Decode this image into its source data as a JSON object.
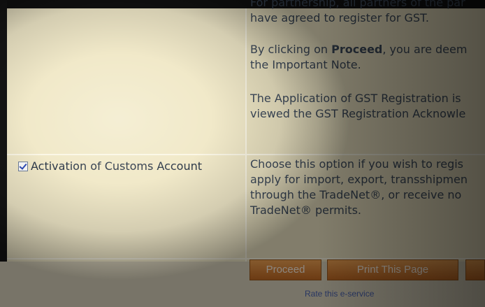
{
  "main": {
    "paragraph1": {
      "line1": "For partnership, all partners of the par",
      "line2": "have agreed to register for GST."
    },
    "paragraph2": {
      "line1_prefix": "By clicking on ",
      "line1_bold": "Proceed",
      "line1_suffix": ", you are deem",
      "line2": "the Important Note."
    },
    "paragraph3": {
      "line1": "The Application of GST Registration is",
      "line2": "viewed the GST Registration Acknowle"
    },
    "option": {
      "label": "Activation of Customs Account",
      "checked": true,
      "description": {
        "line1": "Choose this option if you wish to regis",
        "line2": "apply for import, export, transshipmen",
        "line3": "through the TradeNet®, or receive no",
        "line4": "TradeNet® permits."
      }
    }
  },
  "footer": {
    "proceed_label": "Proceed",
    "print_label": "Print This Page",
    "rate_link": "Rate this e-service"
  },
  "colors": {
    "background": "#f1e9c9",
    "button": "#d9833a",
    "text": "#3d4a5b",
    "link": "#4a63b2"
  }
}
